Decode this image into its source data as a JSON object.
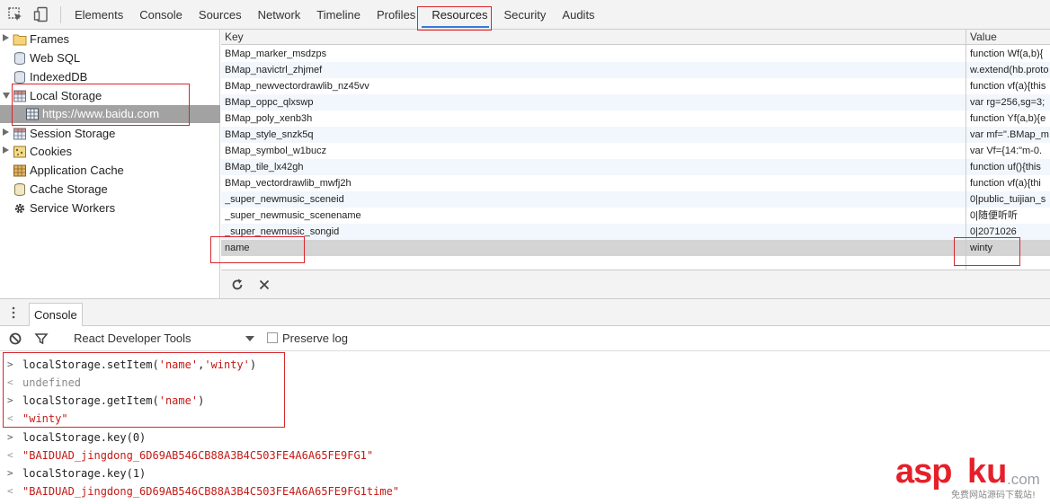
{
  "toolbar": {
    "tabs": [
      "Elements",
      "Console",
      "Sources",
      "Network",
      "Timeline",
      "Profiles",
      "Resources",
      "Security",
      "Audits"
    ],
    "active_tab": "Resources"
  },
  "sidebar": {
    "items": [
      {
        "label": "Frames",
        "icon": "folder-icon"
      },
      {
        "label": "Web SQL",
        "icon": "database-icon"
      },
      {
        "label": "IndexedDB",
        "icon": "database-icon"
      },
      {
        "label": "Local Storage",
        "icon": "storage-grid-icon"
      },
      {
        "label": "https://www.baidu.com",
        "icon": "storage-grid-icon"
      },
      {
        "label": "Session Storage",
        "icon": "storage-grid-icon"
      },
      {
        "label": "Cookies",
        "icon": "cookie-icon"
      },
      {
        "label": "Application Cache",
        "icon": "app-cache-icon"
      },
      {
        "label": "Cache Storage",
        "icon": "database-icon"
      },
      {
        "label": "Service Workers",
        "icon": "gear-icon"
      }
    ]
  },
  "storage_table": {
    "columns": [
      "Key",
      "Value"
    ],
    "rows": [
      {
        "key": "BMap_marker_msdzps",
        "value": "function Wf(a,b){"
      },
      {
        "key": "BMap_navictrl_zhjmef",
        "value": "w.extend(hb.proto"
      },
      {
        "key": "BMap_newvectordrawlib_nz45vv",
        "value": "function vf(a){this"
      },
      {
        "key": "BMap_oppc_qlxswp",
        "value": "var rg=256,sg=3;"
      },
      {
        "key": "BMap_poly_xenb3h",
        "value": "function Yf(a,b){e"
      },
      {
        "key": "BMap_style_snzk5q",
        "value": "var mf=\".BMap_m"
      },
      {
        "key": "BMap_symbol_w1bucz",
        "value": "var Vf={14:\"m-0."
      },
      {
        "key": "BMap_tile_lx42gh",
        "value": "function uf(){this"
      },
      {
        "key": "BMap_vectordrawlib_mwfj2h",
        "value": "function vf(a){thi"
      },
      {
        "key": "_super_newmusic_sceneid",
        "value": "0|public_tuijian_s"
      },
      {
        "key": "_super_newmusic_scenename",
        "value": "0|随便听听"
      },
      {
        "key": "_super_newmusic_songid",
        "value": "0|2071026"
      },
      {
        "key": "name",
        "value": "winty"
      }
    ]
  },
  "drawer": {
    "tab": "Console",
    "context": "React Developer Tools",
    "preserve_log_label": "Preserve log"
  },
  "console": {
    "lines": [
      {
        "type": "input",
        "code_pre": "localStorage.setItem(",
        "arg1": "'name'",
        "sep": ",",
        "arg2": "'winty'",
        "code_post": ")"
      },
      {
        "type": "result",
        "text": "undefined"
      },
      {
        "type": "input",
        "code_pre": "localStorage.getItem(",
        "arg1": "'name'",
        "code_post": ")"
      },
      {
        "type": "result",
        "text": "\"winty\""
      },
      {
        "type": "input",
        "code": "localStorage.key(0)"
      },
      {
        "type": "result",
        "text": "\"BAIDUAD_jingdong_6D69AB546CB88A3B4C503FE4A6A65FE9FG1\""
      },
      {
        "type": "input",
        "code": "localStorage.key(1)"
      },
      {
        "type": "result",
        "text": "\"BAIDUAD_jingdong_6D69AB546CB88A3B4C503FE4A6A65FE9FG1time\""
      }
    ]
  },
  "watermark": {
    "brand_a": "asp",
    "brand_b": "ku",
    "brand_c": ".com",
    "tagline": "免费网站源码下载站!"
  },
  "colors": {
    "highlight": "#d9262c",
    "string": "#c41a16",
    "watermark_red": "#e5202a"
  }
}
